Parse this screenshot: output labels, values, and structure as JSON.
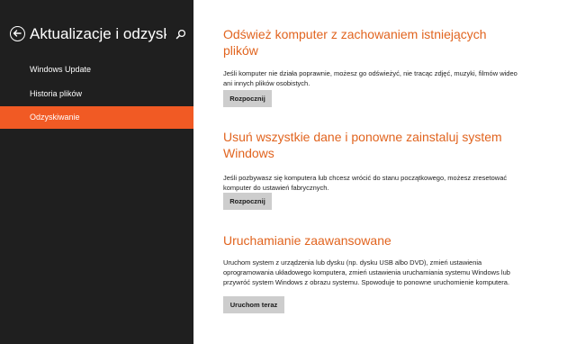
{
  "sidebar": {
    "title": "Aktualizacje i odzyskiwa…",
    "items": [
      {
        "label": "Windows Update",
        "active": false
      },
      {
        "label": "Historia plików",
        "active": false
      },
      {
        "label": "Odzyskiwanie",
        "active": true
      }
    ]
  },
  "sections": [
    {
      "heading": "Odśwież komputer z zachowaniem istniejących plików",
      "description": "Jeśli komputer nie działa poprawnie, możesz go odświeżyć, nie tracąc zdjęć, muzyki, filmów wideo ani innych plików osobistych.",
      "button": "Rozpocznij"
    },
    {
      "heading": "Usuń wszystkie dane i ponowne zainstaluj system Windows",
      "description": "Jeśli pozbywasz się komputera lub chcesz wrócić do stanu początkowego, możesz zresetować komputer do ustawień fabrycznych.",
      "button": "Rozpocznij"
    },
    {
      "heading": "Uruchamianie zaawansowane",
      "description": "Uruchom system z urządzenia lub dysku (np. dysku USB albo DVD), zmień ustawienia oprogramowania układowego komputera, zmień ustawienia uruchamiania systemu Windows lub przywróć system Windows z obrazu systemu. Spowoduje to ponowne uruchomienie komputera.",
      "button": "Uruchom teraz"
    }
  ],
  "colors": {
    "sidebar_background": "#1f1f1f",
    "active_item": "#f15a24",
    "heading_accent": "#e1641f",
    "button_background": "#cdcdcd"
  },
  "icons": {
    "back": "back-arrow-icon",
    "search": "search-icon"
  }
}
